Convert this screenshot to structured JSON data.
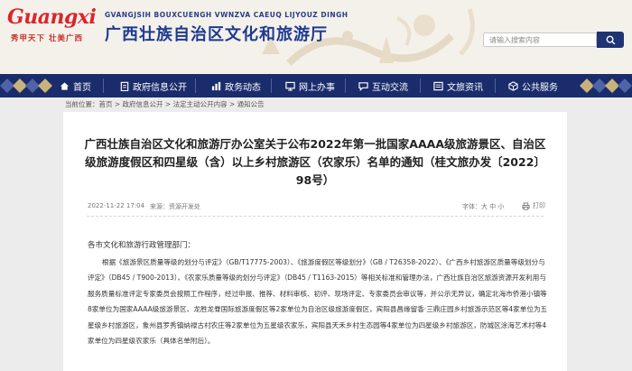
{
  "header": {
    "logo_text": "Guangxi",
    "logo_slogan": "秀甲天下 壮美广西",
    "site_en": "GVANGJSIH BOUXCUENGH VWNZVA CAEUQ LIJYOUZ DINGH",
    "site_cn": "广西壮族自治区文化和旅游厅",
    "search_placeholder": "请输入搜索内容"
  },
  "nav": {
    "items": [
      {
        "label": "首页",
        "icon": "home-icon"
      },
      {
        "label": "政府信息公开",
        "icon": "clipboard-icon"
      },
      {
        "label": "政务动态",
        "icon": "chart-icon"
      },
      {
        "label": "网上办事",
        "icon": "monitor-icon"
      },
      {
        "label": "互动交流",
        "icon": "chat-icon"
      },
      {
        "label": "文旅资讯",
        "icon": "news-icon"
      },
      {
        "label": "公共服务",
        "icon": "cube-icon"
      }
    ]
  },
  "breadcrumb": "当前位置：首页 > 政府信息公开 > 法定主动公开内容 > 通知公告",
  "article": {
    "title": "广西壮族自治区文化和旅游厅办公室关于公布2022年第一批国家AAAA级旅游景区、自治区级旅游度假区和四星级（含）以上乡村旅游区（农家乐）名单的通知（桂文旅办发〔2022〕98号）",
    "date": "2022-11-22 17:04",
    "source": "来源：资源开发处",
    "fontsize": "字体：大 中 小",
    "print": "打印",
    "greeting": "各市文化和旅游行政管理部门：",
    "body": "根据《旅游景区质量等级的划分与评定》（GB/T17775-2003）、《旅游度假区等级划分》（GB / T26358-2022）、《广西乡村旅游区质量等级划分与评定》（DB45 / T900-2013）、《农家乐质量等级的划分与评定》（DB45 / T1163-2015）等相关标准和管理办法，广西壮族自治区旅游资源开发利用与服务质量标准评定专家委员会按照工作程序，经过申报、推荐、材料审核、初评、现场评定、专家委员会审议等，并公示无异议，确定北海市侨港小镇等8家单位为国家AAAA级旅游景区、龙胜龙脊国际旅游度假区等2家单位为自治区级旅游度假区，宾阳县昌缘留香·三鼎庄园乡村旅游示范区等4家单位为五星级乡村旅游区，象州县罗秀镇纳禄古村农庄等2家单位为五星级农家乐，宾阳县天禾乡村生态园等4家单位为四星级乡村旅游区，防城区涂海艺术村等4家单位为四星级农家乐（具体名单附后）。"
  },
  "colors": {
    "nav_bg": "#1a2c6b",
    "title_blue": "#1f3a8f",
    "logo_red": "#d8262d"
  }
}
